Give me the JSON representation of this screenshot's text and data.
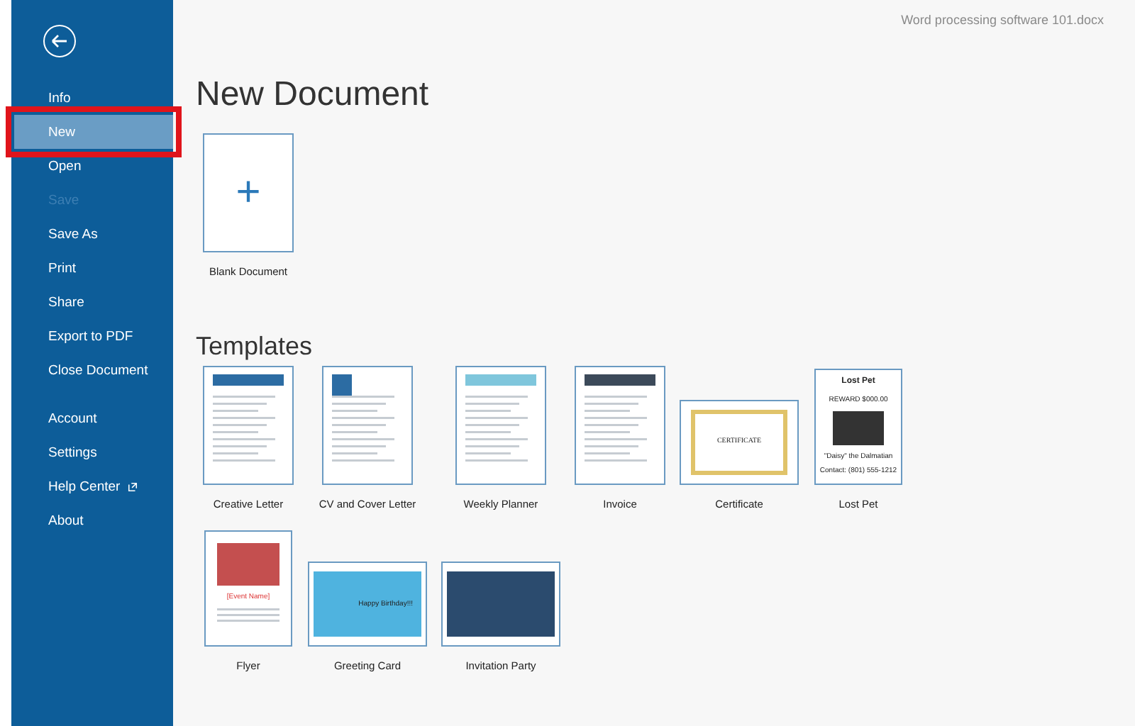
{
  "window": {
    "document_name": "Word processing software 101.docx"
  },
  "sidebar": {
    "groups": [
      {
        "items": [
          {
            "label": "Info",
            "selected": false,
            "disabled": false,
            "external": false,
            "highlighted": false
          },
          {
            "label": "New",
            "selected": true,
            "disabled": false,
            "external": false,
            "highlighted": true
          },
          {
            "label": "Open",
            "selected": false,
            "disabled": false,
            "external": false,
            "highlighted": false
          },
          {
            "label": "Save",
            "selected": false,
            "disabled": true,
            "external": false,
            "highlighted": false
          },
          {
            "label": "Save As",
            "selected": false,
            "disabled": false,
            "external": false,
            "highlighted": false
          },
          {
            "label": "Print",
            "selected": false,
            "disabled": false,
            "external": false,
            "highlighted": false
          },
          {
            "label": "Share",
            "selected": false,
            "disabled": false,
            "external": false,
            "highlighted": false
          },
          {
            "label": "Export to PDF",
            "selected": false,
            "disabled": false,
            "external": false,
            "highlighted": false
          },
          {
            "label": "Close Document",
            "selected": false,
            "disabled": false,
            "external": false,
            "highlighted": false
          }
        ]
      },
      {
        "items": [
          {
            "label": "Account",
            "selected": false,
            "disabled": false,
            "external": false,
            "highlighted": false
          },
          {
            "label": "Settings",
            "selected": false,
            "disabled": false,
            "external": false,
            "highlighted": false
          },
          {
            "label": "Help Center",
            "selected": false,
            "disabled": false,
            "external": true,
            "highlighted": false
          },
          {
            "label": "About",
            "selected": false,
            "disabled": false,
            "external": false,
            "highlighted": false
          }
        ]
      }
    ]
  },
  "main": {
    "title": "New Document",
    "blank": {
      "label": "Blank Document",
      "icon": "+"
    },
    "templates_heading": "Templates",
    "templates": [
      {
        "label": "Creative Letter",
        "kind": "letter"
      },
      {
        "label": "CV and Cover Letter",
        "kind": "cv"
      },
      {
        "label": "Weekly Planner",
        "kind": "planner"
      },
      {
        "label": "Invoice",
        "kind": "invoice"
      },
      {
        "label": "Certificate",
        "kind": "certificate",
        "preview_text": [
          "CERTIFICATE"
        ]
      },
      {
        "label": "Lost Pet",
        "kind": "poster",
        "preview_text": [
          "Lost Pet",
          "REWARD $000.00",
          "\"Daisy\" the Dalmatian",
          "Contact: (801) 555-1212"
        ]
      },
      {
        "label": "Flyer",
        "kind": "flyer",
        "preview_text": [
          "[Event Name]"
        ]
      },
      {
        "label": "Greeting Card",
        "kind": "card",
        "preview_text": [
          "Happy Birthday!!!"
        ]
      },
      {
        "label": "Invitation Party",
        "kind": "party"
      }
    ]
  }
}
